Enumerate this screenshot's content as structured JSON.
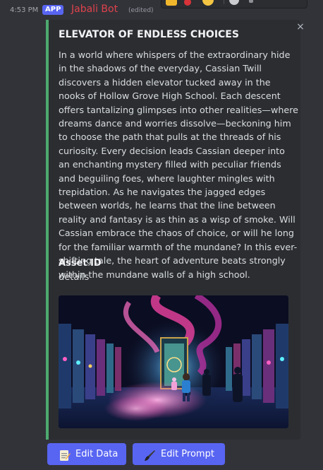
{
  "message": {
    "time": "4:53 PM",
    "app_badge": "APP",
    "bot_name": "Jabali Bot",
    "edited": "(edited)"
  },
  "embed": {
    "title": "ELEVATOR OF ENDLESS CHOICES",
    "description": "In a world where whispers of the extraordinary hide in the shadows of the everyday, Cassian Twill discovers a hidden elevator tucked away in the nooks of Hollow Grove High School. Each descent offers tantalizing glimpses into other realities—where dreams dance and worries dissolve—beckoning him to choose the path that pulls at the threads of his curiosity. Every decision leads Cassian deeper into an enchanting mystery filled with peculiar friends and beguiling foes, where laughter mingles with trepidation. As he navigates the jagged edges between worlds, he learns that the line between reality and fantasy is as thin as a wisp of smoke. Will Cassian embrace the chaos of choice, or will he long for the familiar warmth of the mundane? In this ever-shifting tale, the heart of adventure beats strongly within the mundane walls of a high school.",
    "field_name": "Asset ID",
    "field_value": "details",
    "close_icon": "×",
    "accent_color": "#4ea96f"
  },
  "buttons": [
    {
      "label": "Edit Data",
      "icon": "memo-icon"
    },
    {
      "label": "Edit Prompt",
      "icon": "paintbrush-icon"
    }
  ],
  "colors": {
    "background": "#323339",
    "embed_bg": "#2b2d31",
    "button": "#5865f2",
    "bot_name": "#e0424c"
  }
}
